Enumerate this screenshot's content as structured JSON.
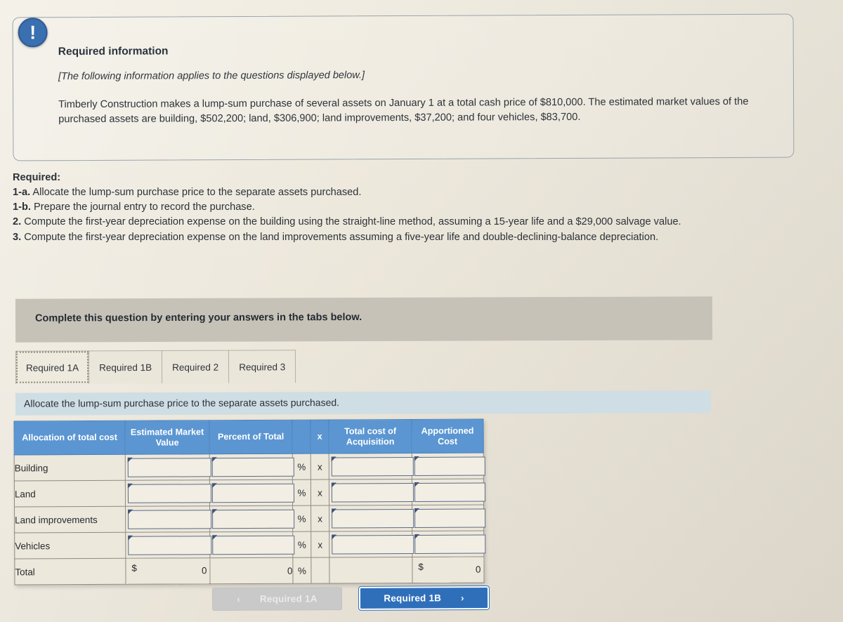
{
  "callout": {
    "icon": "info-exclamation-icon",
    "title": "Required information",
    "note": "[The following information applies to the questions displayed below.]",
    "body": "Timberly Construction makes a lump-sum purchase of several assets on January 1 at a total cash price of $810,000. The estimated market values of the purchased assets are building, $502,200; land, $306,900; land improvements, $37,200; and four vehicles, $83,700."
  },
  "required": {
    "heading": "Required:",
    "items": [
      {
        "num": "1-a.",
        "text": "Allocate the lump-sum purchase price to the separate assets purchased."
      },
      {
        "num": "1-b.",
        "text": "Prepare the journal entry to record the purchase."
      },
      {
        "num": "2.",
        "text": "Compute the first-year depreciation expense on the building using the straight-line method, assuming a 15-year life and a $29,000 salvage value."
      },
      {
        "num": "3.",
        "text": "Compute the first-year depreciation expense on the land improvements assuming a five-year life and double-declining-balance depreciation."
      }
    ]
  },
  "complete_bar": {
    "text": "Complete this question by entering your answers in the tabs below."
  },
  "tabs": [
    {
      "label": "Required 1A",
      "active": true
    },
    {
      "label": "Required 1B",
      "active": false
    },
    {
      "label": "Required 2",
      "active": false
    },
    {
      "label": "Required 3",
      "active": false
    }
  ],
  "instruction": {
    "text": "Allocate the lump-sum purchase price to the separate assets purchased."
  },
  "table": {
    "headers": [
      "Allocation of total cost",
      "Estimated Market Value",
      "Percent of Total",
      "x",
      "Total cost of Acquisition",
      "Apportioned Cost"
    ],
    "rows": [
      {
        "label": "Building",
        "estimated_market_value": "",
        "percent_of_total": "",
        "percent_sign": "%",
        "times": "x",
        "total_cost_of_acquisition": "",
        "apportioned_cost": ""
      },
      {
        "label": "Land",
        "estimated_market_value": "",
        "percent_of_total": "",
        "percent_sign": "%",
        "times": "x",
        "total_cost_of_acquisition": "",
        "apportioned_cost": ""
      },
      {
        "label": "Land improvements",
        "estimated_market_value": "",
        "percent_of_total": "",
        "percent_sign": "%",
        "times": "x",
        "total_cost_of_acquisition": "",
        "apportioned_cost": ""
      },
      {
        "label": "Vehicles",
        "estimated_market_value": "",
        "percent_of_total": "",
        "percent_sign": "%",
        "times": "x",
        "total_cost_of_acquisition": "",
        "apportioned_cost": ""
      }
    ],
    "total_row": {
      "label": "Total",
      "emv_currency": "$",
      "emv_value": "0",
      "percent_value": "0",
      "percent_sign": "%",
      "apportioned_currency": "$",
      "apportioned_value": "0"
    }
  },
  "footer": {
    "prev_label": "Required 1A",
    "prev_chevron": "‹",
    "next_label": "Required 1B",
    "next_chevron": "›"
  },
  "colors": {
    "page_bg": "#ece7dc",
    "header_blue": "#5b96d2",
    "instruction_blue": "#cfdde4",
    "complete_gray": "#c6c2b8",
    "primary_button": "#2f6fba",
    "disabled_button": "#c9c9c9",
    "icon_blue": "#3a6fb0"
  }
}
